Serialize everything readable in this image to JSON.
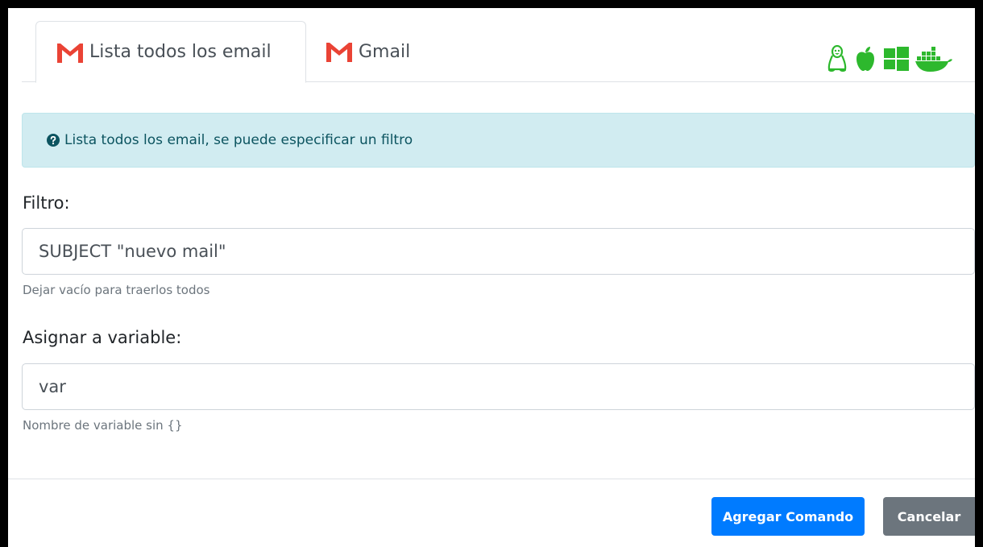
{
  "tabs": [
    {
      "label": "Lista todos los email",
      "icon": "gmail-icon",
      "active": true
    },
    {
      "label": "Gmail",
      "icon": "gmail-icon",
      "active": false
    }
  ],
  "os_icons": [
    "linux-icon",
    "apple-icon",
    "windows-icon",
    "docker-icon"
  ],
  "colors": {
    "gmail_red": "#EA4335",
    "os_green": "#2DB82D",
    "alert_bg": "#D1ECF1",
    "alert_text": "#0C5460",
    "primary": "#007BFF",
    "secondary": "#6C757D"
  },
  "alert": {
    "text": "Lista todos los email, se puede especificar un filtro"
  },
  "filter": {
    "label": "Filtro:",
    "value": "SUBJECT \"nuevo mail\"",
    "help": "Dejar vacío para traerlos todos"
  },
  "variable": {
    "label": "Asignar a variable:",
    "value": "var",
    "help": "Nombre de variable sin {}"
  },
  "footer": {
    "primary_label": "Agregar Comando",
    "secondary_label": "Cancelar"
  }
}
